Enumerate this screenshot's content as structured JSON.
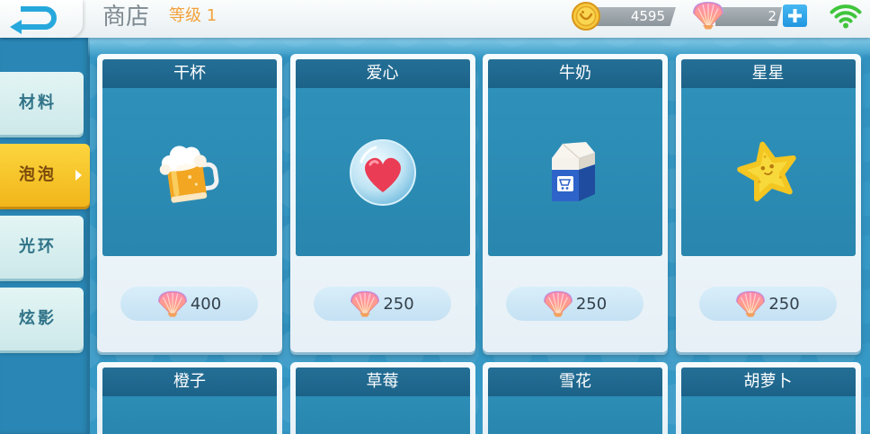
{
  "header": {
    "title": "商店",
    "level": "等级 1"
  },
  "currency": {
    "coins": "4595",
    "shells": "2"
  },
  "icons": {
    "back": "back-arrow-icon",
    "coin": "coin-icon",
    "shell": "shell-icon",
    "add": "plus-icon",
    "signal": "wifi-icon"
  },
  "tabs": [
    {
      "label": "材料",
      "selected": false
    },
    {
      "label": "泡泡",
      "selected": true
    },
    {
      "label": "光环",
      "selected": false
    },
    {
      "label": "炫影",
      "selected": false
    }
  ],
  "items": [
    {
      "name": "干杯",
      "price": "400",
      "icon": "beer-mug-icon"
    },
    {
      "name": "爱心",
      "price": "250",
      "icon": "heart-bubble-icon"
    },
    {
      "name": "牛奶",
      "price": "250",
      "icon": "milk-carton-icon"
    },
    {
      "name": "星星",
      "price": "250",
      "icon": "starfish-icon"
    },
    {
      "name": "橙子"
    },
    {
      "name": "草莓"
    },
    {
      "name": "雪花"
    },
    {
      "name": "胡萝卜"
    }
  ],
  "colors": {
    "tab_selected": "#f5c424",
    "tab_default": "#d7eeee",
    "item_panel": "#2d8fb8",
    "item_title_bar": "#1f6990",
    "level_text": "#f2a23c",
    "back_icon": "#27a8dc",
    "wifi": "#3fc53a"
  }
}
